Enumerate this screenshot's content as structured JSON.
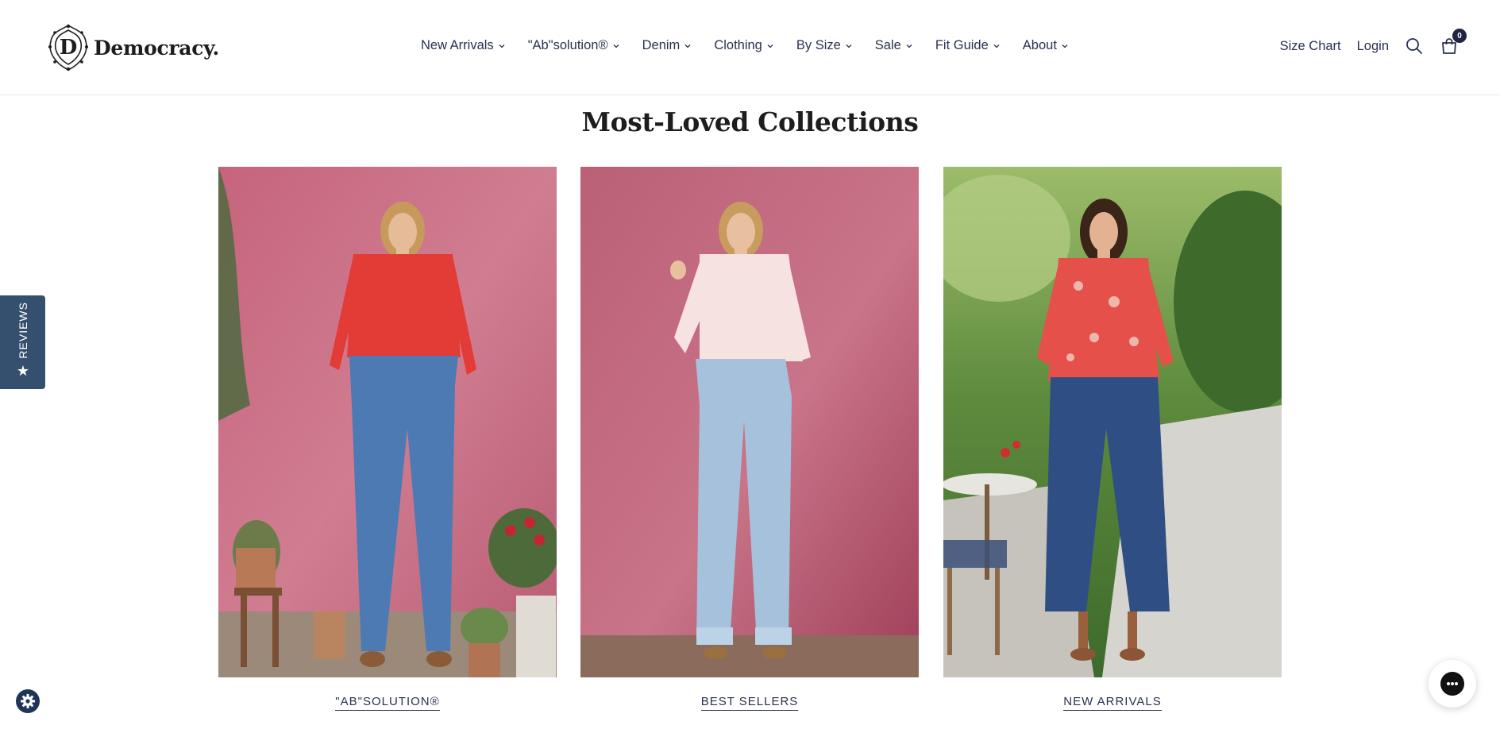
{
  "brand": {
    "name": "Democracy."
  },
  "nav": {
    "items": [
      {
        "label": "New Arrivals"
      },
      {
        "label": "\"Ab\"solution®"
      },
      {
        "label": "Denim"
      },
      {
        "label": "Clothing"
      },
      {
        "label": "By Size"
      },
      {
        "label": "Sale"
      },
      {
        "label": "Fit Guide"
      },
      {
        "label": "About"
      }
    ]
  },
  "tools": {
    "size_chart": "Size Chart",
    "login": "Login",
    "cart_count": "0"
  },
  "section": {
    "title": "Most-Loved Collections"
  },
  "collections": [
    {
      "label": "\"AB\"SOLUTION®",
      "image": "woman in red sweater and flare jeans against pink wall"
    },
    {
      "label": "BEST SELLERS",
      "image": "woman in white top and light wide-leg jeans against pink wall"
    },
    {
      "label": "NEW ARRIVALS",
      "image": "woman in red floral blouse and dark cropped jeans in garden"
    }
  ],
  "reviews_tab": {
    "label": "REVIEWS"
  },
  "colors": {
    "nav_text": "#2b3150",
    "reviews_tab": "#34506e",
    "badge": "#1f2540"
  },
  "icons": [
    "search-icon",
    "cart-icon",
    "chevron-down-icon",
    "star-icon",
    "gear-icon",
    "chat-icon"
  ]
}
